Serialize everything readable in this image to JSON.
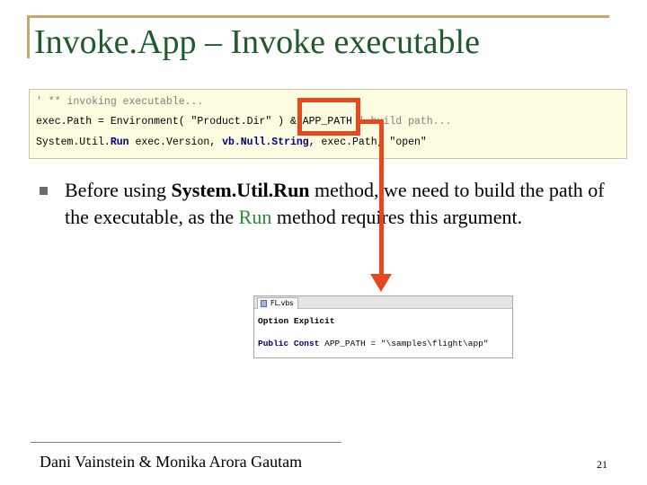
{
  "slide": {
    "title": "Invoke.App – Invoke executable",
    "page_number": "21",
    "footer_author": "Dani Vainstein & Monika Arora Gautam"
  },
  "code": {
    "line1": "' ** invoking executable...",
    "line2_pre": "exec.Path = Environment( \"Product.Dir\" ) & ",
    "line2_highlight": "APP_PATH",
    "line2_post": " ' build path...",
    "line3_pre": "System.Util.",
    "line3_run": "Run",
    "line3_mid": " exec.Version, ",
    "line3_null": "vb.Null.String",
    "line3_post": ", exec.Path, \"open\""
  },
  "bullet": {
    "part1": "Before using ",
    "part2_bold": "System.Util.Run",
    "part3": " method, we need to build the path of the executable, as the ",
    "part4_green": "Run",
    "part5": " method requires this argument."
  },
  "file_snippet": {
    "tab_label": "FL.vbs",
    "line1_kw": "Option Explicit",
    "line2_kw": "Public Const",
    "line2_rest": " APP_PATH = \"\\samples\\flight\\app\""
  },
  "colors": {
    "title": "#1f5a2a",
    "highlight": "#e8481e",
    "green_text": "#2b8a2b",
    "code_background": "#fdfbe0"
  }
}
